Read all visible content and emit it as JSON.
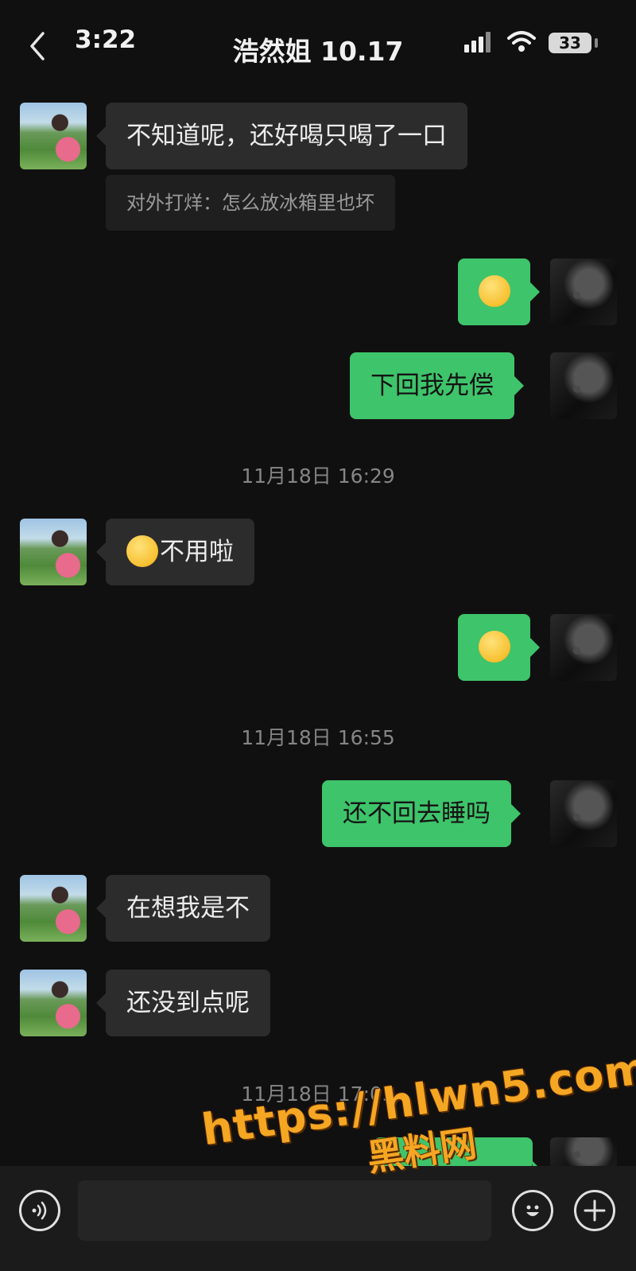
{
  "status": {
    "time": "3:22",
    "battery": "33"
  },
  "header": {
    "title": "浩然姐 10.17"
  },
  "messages": {
    "m1": "不知道呢，还好喝只喝了一口",
    "quote": "对外打烊：怎么放冰箱里也坏",
    "m3": "下回我先偿",
    "ts1": "11月18日 16:29",
    "m4": "不用啦",
    "ts2": "11月18日 16:55",
    "m6": "还不回去睡吗",
    "m7": "在想我是不",
    "m8": "还没到点呢",
    "ts3": "11月18日 17:03"
  },
  "icons": {
    "back": "chevron-left-icon",
    "signal": "signal-icon",
    "wifi": "wifi-icon",
    "voice": "voice-icon",
    "emoji": "emoji-icon",
    "plus": "plus-icon"
  },
  "colors": {
    "outgoing_bubble": "#3ec46a",
    "incoming_bubble": "#2d2c2d",
    "watermark": "#f5a623"
  },
  "watermark": {
    "url": "https://hlwn5.com",
    "brand": "黑料网"
  }
}
